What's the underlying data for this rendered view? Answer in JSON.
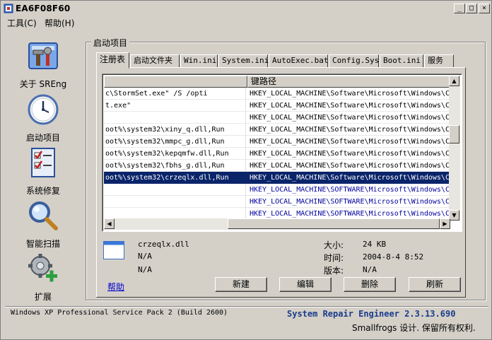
{
  "window": {
    "title": "EA6F08F60"
  },
  "titlebar_buttons": {
    "minimize": "_",
    "maximize": "□",
    "close": "×"
  },
  "menu": {
    "tools": "工具(C)",
    "help": "帮助(H)"
  },
  "nav": [
    {
      "label": "关于 SREng",
      "icon": "tools-icon"
    },
    {
      "label": "启动项目",
      "icon": "clock-icon"
    },
    {
      "label": "系统修复",
      "icon": "checklist-icon"
    },
    {
      "label": "智能扫描",
      "icon": "magnifier-icon"
    },
    {
      "label": "扩展",
      "icon": "gear-plus-icon"
    }
  ],
  "group_title": "启动项目",
  "tabs": [
    "注册表",
    "启动文件夹",
    "Win.ini",
    "System.ini",
    "AutoExec.bat",
    "Config.Sys",
    "Boot.ini",
    "服务"
  ],
  "list": {
    "columns": [
      "",
      "键路径"
    ],
    "rows": [
      {
        "c1": "c\\StormSet.exe\" /S /opti",
        "c2": "HKEY_LOCAL_MACHINE\\Software\\Microsoft\\Windows\\C",
        "selected": false,
        "blue": false
      },
      {
        "c1": "t.exe\"",
        "c2": "HKEY_LOCAL_MACHINE\\Software\\Microsoft\\Windows\\C",
        "selected": false,
        "blue": false
      },
      {
        "c1": "",
        "c2": "HKEY_LOCAL_MACHINE\\Software\\Microsoft\\Windows\\C",
        "selected": false,
        "blue": false
      },
      {
        "c1": "oot%\\system32\\xiny_q.dll,Run",
        "c2": "HKEY_LOCAL_MACHINE\\Software\\Microsoft\\Windows\\C",
        "selected": false,
        "blue": false
      },
      {
        "c1": "oot%\\system32\\mmpc_g.dll,Run",
        "c2": "HKEY_LOCAL_MACHINE\\Software\\Microsoft\\Windows\\C",
        "selected": false,
        "blue": false
      },
      {
        "c1": "oot%\\system32\\kepqmfw.dll,Run",
        "c2": "HKEY_LOCAL_MACHINE\\Software\\Microsoft\\Windows\\C",
        "selected": false,
        "blue": false
      },
      {
        "c1": "oot%\\system32\\fbhs_g.dll,Run",
        "c2": "HKEY_LOCAL_MACHINE\\Software\\Microsoft\\Windows\\C",
        "selected": false,
        "blue": false
      },
      {
        "c1": "oot%\\system32\\crzeqlx.dll,Run",
        "c2": "HKEY_LOCAL_MACHINE\\Software\\Microsoft\\Windows\\C",
        "selected": true,
        "blue": false
      },
      {
        "c1": "",
        "c2": "HKEY_LOCAL_MACHINE\\SOFTWARE\\Microsoft\\Windows\\C",
        "selected": false,
        "blue": true
      },
      {
        "c1": "",
        "c2": "HKEY_LOCAL_MACHINE\\SOFTWARE\\Microsoft\\Windows\\C",
        "selected": false,
        "blue": true
      },
      {
        "c1": "",
        "c2": "HKEY_LOCAL_MACHINE\\SOFTWARE\\Microsoft\\Windows\\C",
        "selected": false,
        "blue": true
      }
    ]
  },
  "details": {
    "filename": "crzeqlx.dll",
    "line2": "N/A",
    "line3": "N/A",
    "size_label": "大小:",
    "size_value": "24 KB",
    "time_label": "时间:",
    "time_value": "2004-8-4 8:52",
    "version_label": "版本:",
    "version_value": "N/A"
  },
  "buttons": {
    "help": "帮助",
    "new": "新建",
    "edit": "编辑",
    "delete": "删除",
    "refresh": "刷新"
  },
  "status": {
    "os": "Windows XP Professional Service Pack 2 (Build 2600)",
    "product": "System Repair Engineer 2.3.13.690",
    "copyright": "Smallfrogs 设计. 保留所有权利."
  },
  "colors": {
    "selection": "#0a246a",
    "product_text": "#1a3c8a",
    "link": "#0000cc"
  }
}
